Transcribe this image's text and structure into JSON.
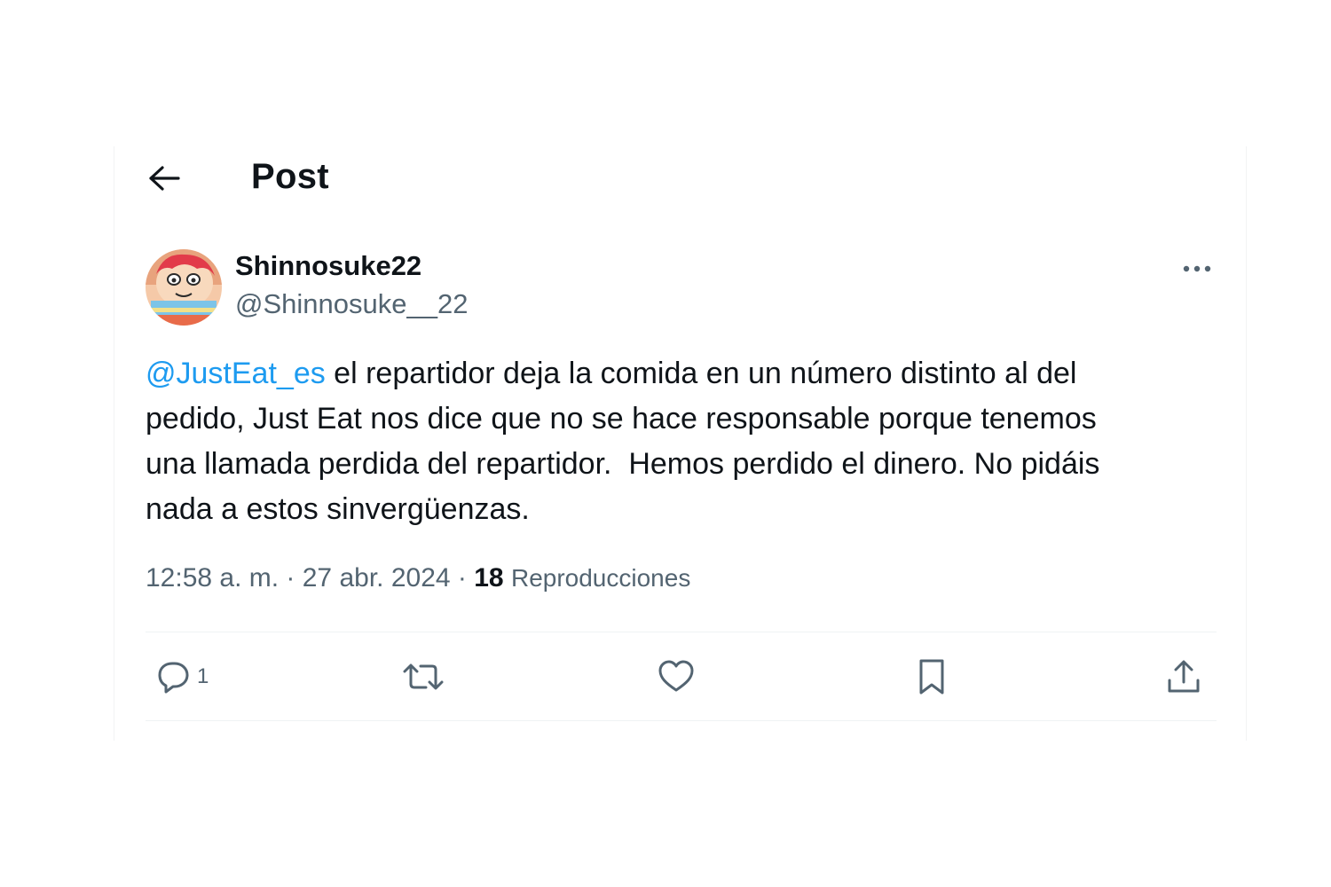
{
  "header": {
    "title": "Post",
    "back_icon": "arrow-left-icon"
  },
  "author": {
    "display_name": "Shinnosuke22",
    "handle": "@Shinnosuke__22",
    "avatar_icon": "avatar-cartoon-icon"
  },
  "post": {
    "mention": "@JustEat_es",
    "text": " el repartidor deja la comida en un número distinto al del\npedido, Just Eat nos dice que no se hace responsable porque tenemos\nuna llamada perdida del repartidor.  Hemos perdido el dinero. No pidáis\nnada a estos sinvergüenzas.",
    "timestamp": "12:58 a. m. · 27 abr. 2024",
    "separator": " · ",
    "views_count": "18",
    "views_label": "Reproducciones"
  },
  "actions": {
    "reply_count": "1",
    "icons": [
      "reply-icon",
      "repost-icon",
      "like-icon",
      "bookmark-icon",
      "share-icon"
    ]
  },
  "colors": {
    "text_primary": "#0f1419",
    "text_secondary": "#536471",
    "accent": "#1d9bf0",
    "divider": "#eff3f4"
  }
}
